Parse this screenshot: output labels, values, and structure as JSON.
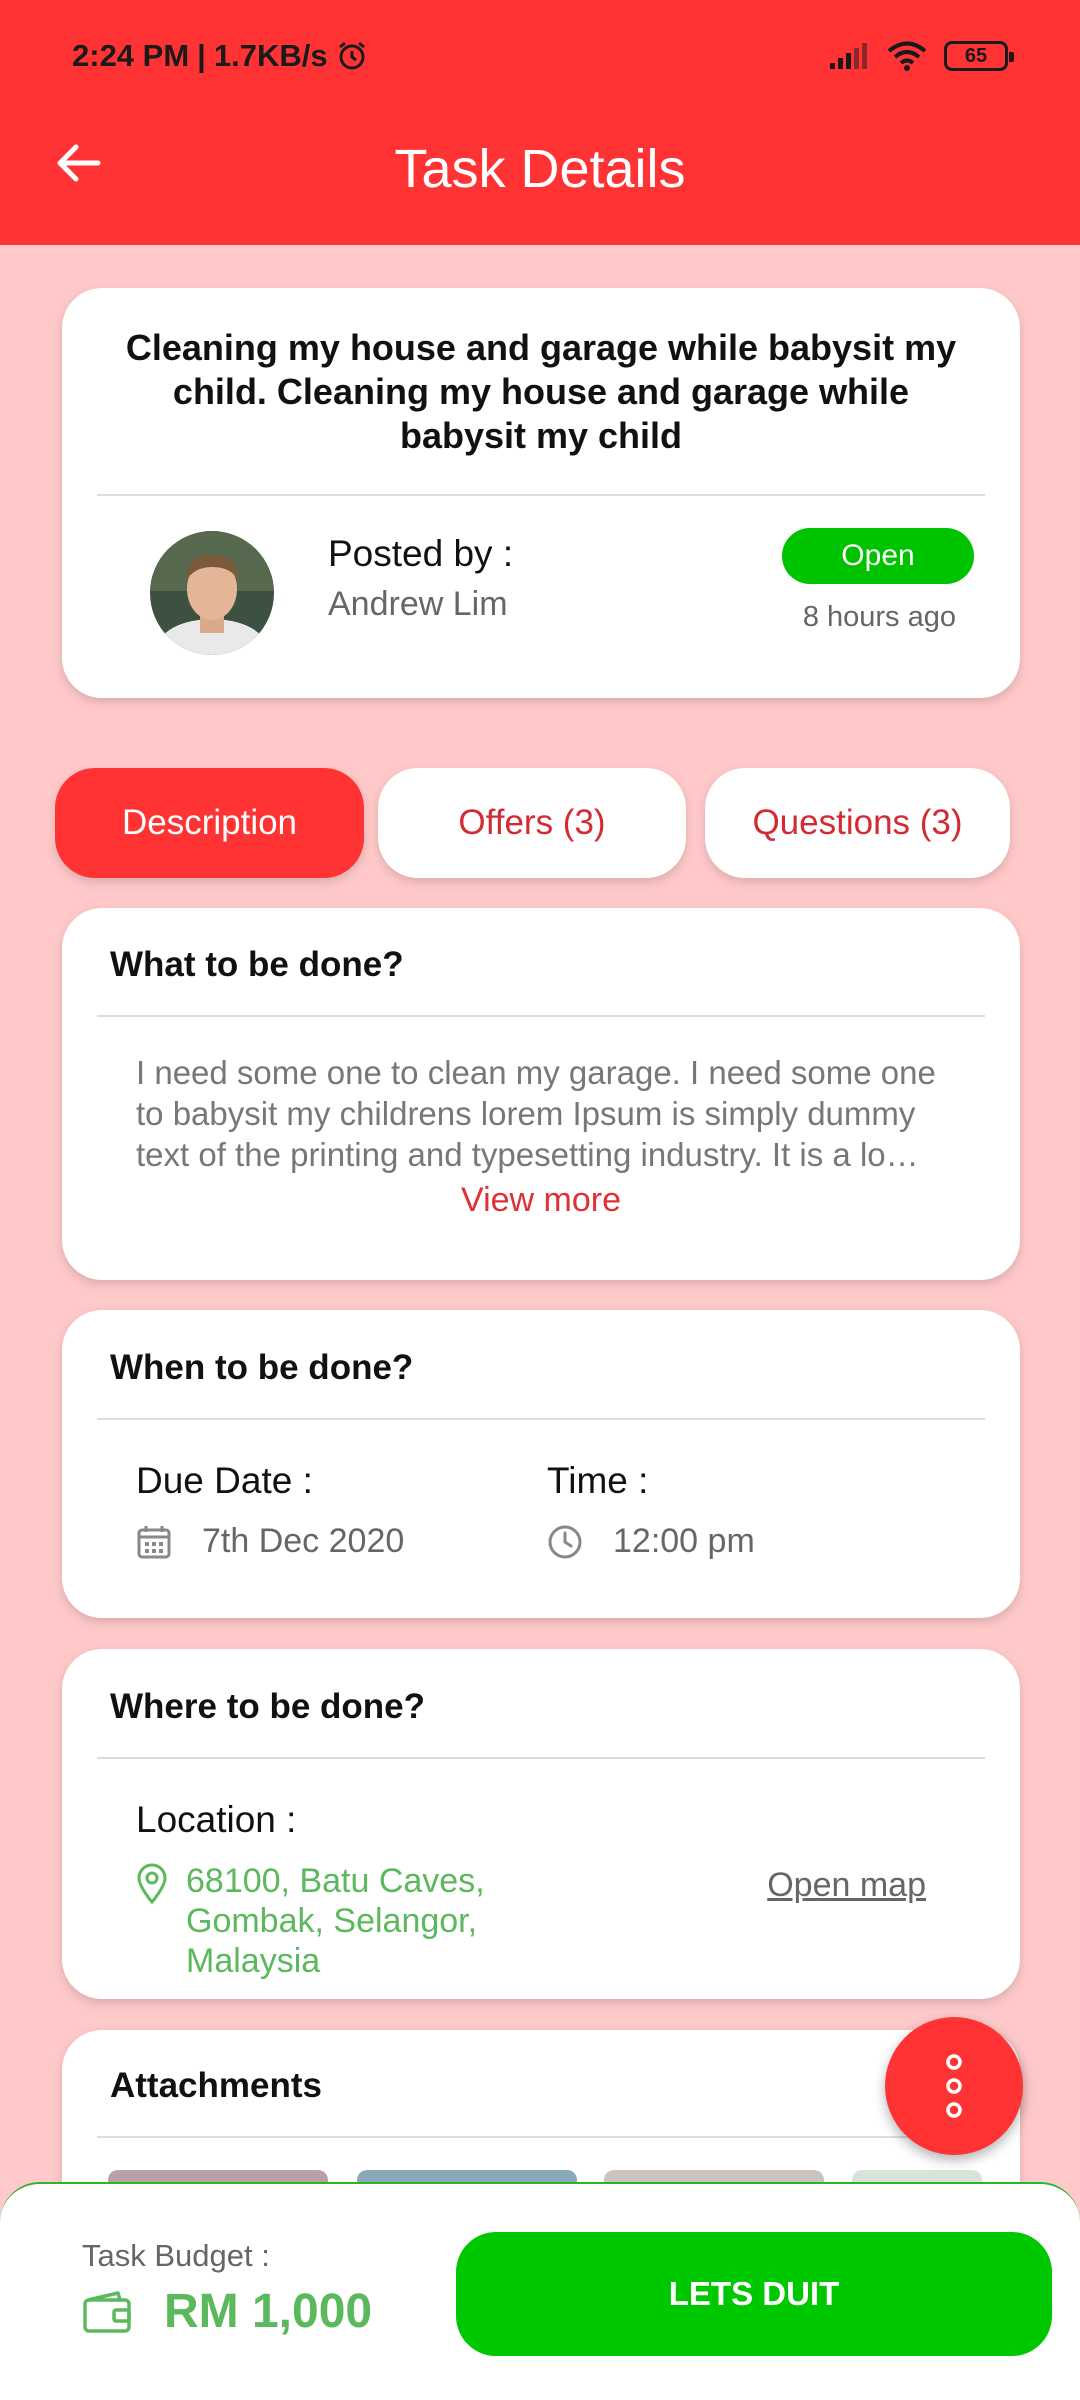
{
  "status_bar": {
    "time": "2:24 PM",
    "network_speed": "1.7KB/s",
    "battery": "65"
  },
  "header": {
    "title": "Task Details",
    "back_icon": "arrow-left-icon"
  },
  "task": {
    "title": "Cleaning my house and garage while babysit my child. Cleaning my house and garage while babysit my child",
    "posted_by_label": "Posted by :",
    "poster_name": "Andrew Lim",
    "status": "Open",
    "posted_time": "8 hours ago"
  },
  "tabs": [
    {
      "label": "Description",
      "active": true
    },
    {
      "label": "Offers (3)",
      "active": false
    },
    {
      "label": "Questions (3)",
      "active": false
    }
  ],
  "description": {
    "title": "What to be done?",
    "text": "I need some one to clean my garage. I need some one to babysit my childrens lorem Ipsum is simply dummy text of the printing and typesetting industry. It is a lo…",
    "view_more": "View more"
  },
  "when": {
    "title": "When to be done?",
    "due_label": "Due Date :",
    "due_value": "7th Dec 2020",
    "time_label": "Time :",
    "time_value": "12:00 pm"
  },
  "where": {
    "title": "Where to be done?",
    "location_label": "Location :",
    "location_value": "68100, Batu Caves, Gombak, Selangor, Malaysia",
    "open_map": "Open map"
  },
  "attachments": {
    "title": "Attachments"
  },
  "bottom": {
    "budget_label": "Task Budget :",
    "budget_value": "RM 1,000",
    "cta": "LETS DUIT"
  },
  "colors": {
    "primary": "#ff3334",
    "background": "#ffc9c9",
    "green": "#00c800",
    "green_text": "#5cb85c"
  }
}
